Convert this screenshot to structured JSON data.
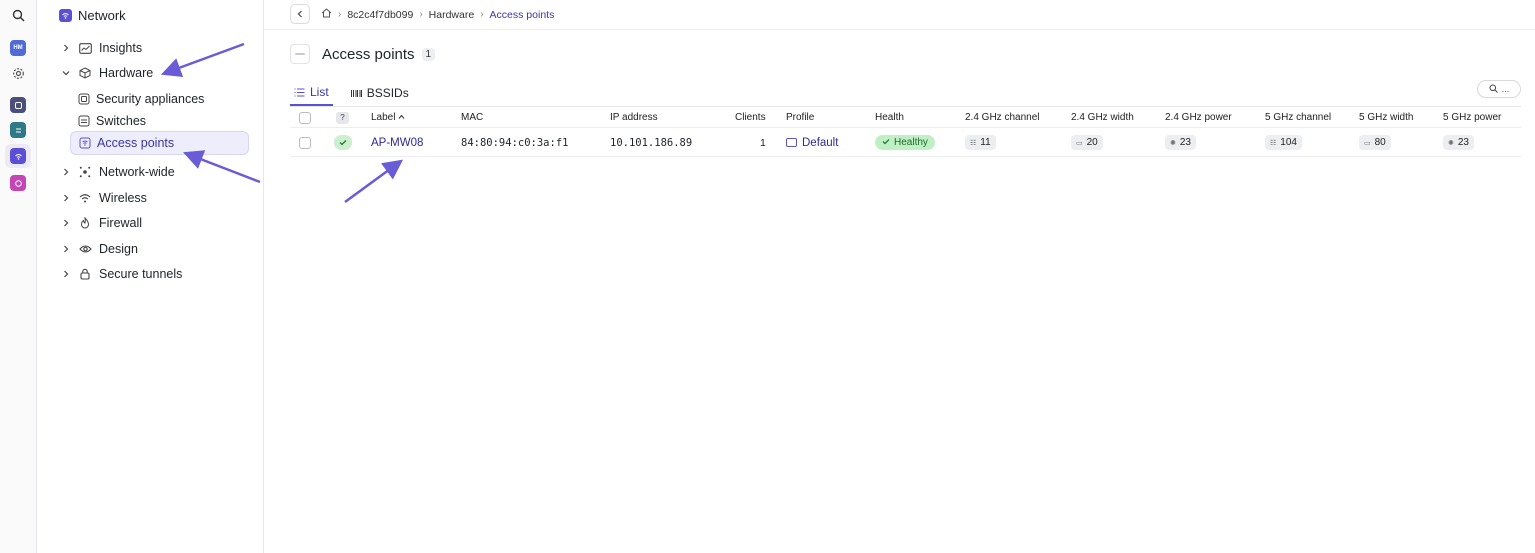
{
  "rail": {
    "items": [
      {
        "name": "search-icon"
      },
      {
        "name": "hm-app",
        "label": "HM",
        "color": "#4f6bd8"
      },
      {
        "name": "gear-icon"
      },
      {
        "name": "security-app",
        "color": "#4a4f7c"
      },
      {
        "name": "sd-app",
        "color": "#2f7a88"
      },
      {
        "name": "network-app",
        "color": "#5b4fd6"
      },
      {
        "name": "pink-app",
        "color": "#c246b6"
      }
    ]
  },
  "sidebar": {
    "title": "Network",
    "items": [
      {
        "label": "Insights",
        "icon": "chart-icon",
        "expanded": false
      },
      {
        "label": "Hardware",
        "icon": "box-icon",
        "expanded": true
      },
      {
        "label": "Network-wide",
        "icon": "network-icon",
        "expanded": false
      },
      {
        "label": "Wireless",
        "icon": "wifi-icon",
        "expanded": false
      },
      {
        "label": "Firewall",
        "icon": "fire-icon",
        "expanded": false
      },
      {
        "label": "Design",
        "icon": "eye-icon",
        "expanded": false
      },
      {
        "label": "Secure tunnels",
        "icon": "lock-icon",
        "expanded": false
      }
    ],
    "hardware_children": [
      {
        "label": "Security appliances",
        "icon": "security-appliance-icon"
      },
      {
        "label": "Switches",
        "icon": "switch-icon"
      },
      {
        "label": "Access points",
        "icon": "access-point-icon",
        "active": true
      }
    ]
  },
  "breadcrumb": {
    "items": [
      "8c2c4f7db099",
      "Hardware",
      "Access points"
    ]
  },
  "page": {
    "title": "Access points",
    "count": "1"
  },
  "tabs": [
    {
      "label": "List",
      "active": true
    },
    {
      "label": "BSSIDs",
      "active": false
    }
  ],
  "search": {
    "label": "..."
  },
  "table": {
    "columns": [
      "Label",
      "MAC",
      "IP address",
      "Clients",
      "Profile",
      "Health",
      "2.4 GHz channel",
      "2.4 GHz width",
      "2.4 GHz power",
      "5 GHz channel",
      "5 GHz width",
      "5 GHz power"
    ],
    "status_header": "?",
    "sort_indicator": "^",
    "rows": [
      {
        "label": "AP-MW08",
        "mac": "84:80:94:c0:3a:f1",
        "ip": "10.101.186.89",
        "clients": "1",
        "profile": "Default",
        "health": "Healthy",
        "ch24": "11",
        "w24": "20",
        "p24": "23",
        "ch5": "104",
        "w5": "80",
        "p5": "23"
      }
    ]
  },
  "colors": {
    "accent": "#5b4fd6",
    "healthy_bg": "#bff0c4",
    "annotation_arrow": "#6a5bd6"
  }
}
